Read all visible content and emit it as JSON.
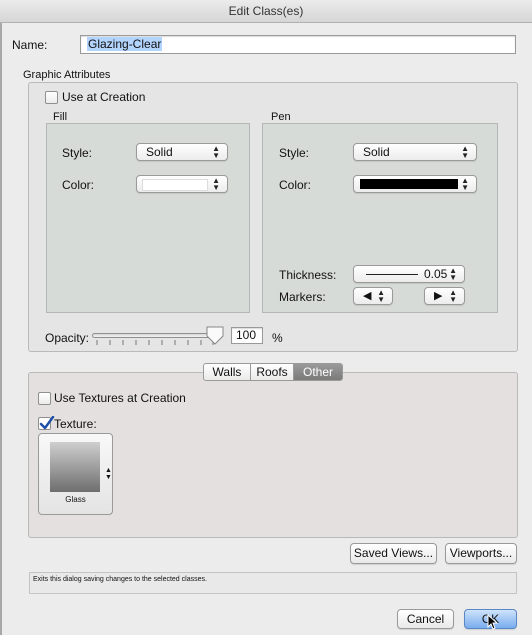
{
  "window": {
    "title": "Edit Class(es)"
  },
  "name": {
    "label": "Name:",
    "value": "Glazing-Clear"
  },
  "graphic": {
    "title": "Graphic Attributes",
    "use_at_creation": "Use at Creation",
    "fill": {
      "title": "Fill",
      "style_label": "Style:",
      "style_value": "Solid",
      "color_label": "Color:",
      "color_value": "#ffffff"
    },
    "pen": {
      "title": "Pen",
      "style_label": "Style:",
      "style_value": "Solid",
      "color_label": "Color:",
      "color_value": "#000000",
      "thickness_label": "Thickness:",
      "thickness_value": "0.05",
      "markers_label": "Markers:"
    },
    "opacity": {
      "label": "Opacity:",
      "value": "100",
      "unit": "%",
      "level": 1.0
    }
  },
  "tabs": {
    "items": [
      "Walls",
      "Roofs",
      "Other"
    ],
    "selected": "Other"
  },
  "textures": {
    "use_at_creation": "Use Textures at Creation",
    "texture_label": "Texture:",
    "texture_name": "Glass"
  },
  "buttons": {
    "saved_views": "Saved Views...",
    "viewports": "Viewports...",
    "cancel": "Cancel",
    "ok": "OK"
  },
  "help_text": "Exits this dialog saving changes to the selected classes.",
  "icons": {
    "up_down": "updown-arrows-icon",
    "left": "triangle-left-icon",
    "right": "triangle-right-icon",
    "check": "checkmark-icon"
  }
}
